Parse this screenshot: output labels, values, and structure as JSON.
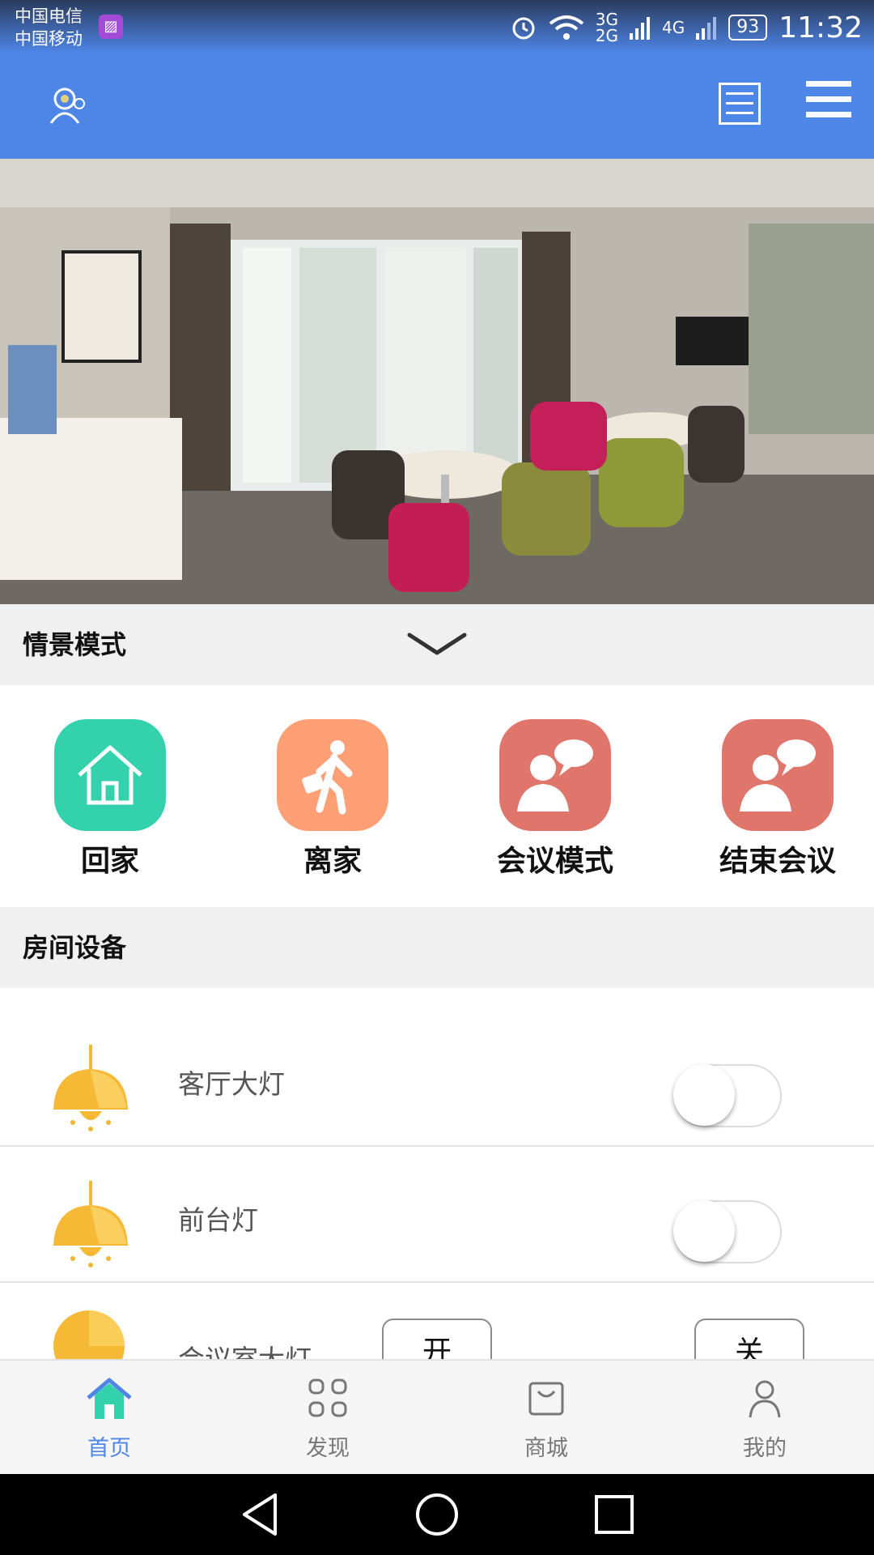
{
  "status_bar": {
    "carrier_1": "中国电信",
    "carrier_2": "中国移动",
    "network_3g": "3G",
    "network_2g": "2G",
    "network_4g": "4G",
    "battery": "93",
    "time": "11:32"
  },
  "header": {
    "left_icon": "user-camera-icon",
    "right_icons": [
      "list-icon",
      "menu-icon"
    ]
  },
  "scene_section": {
    "title": "情景模式",
    "scenes": [
      {
        "label": "回家",
        "icon": "home-icon",
        "color": "#33d1ac"
      },
      {
        "label": "离家",
        "icon": "walking-out-icon",
        "color": "#ff9f76"
      },
      {
        "label": "会议模式",
        "icon": "meeting-icon",
        "color": "#e0756c"
      },
      {
        "label": "结束会议",
        "icon": "meeting-end-icon",
        "color": "#e0756c"
      }
    ]
  },
  "device_section": {
    "title": "房间设备",
    "devices": [
      {
        "name": "客厅大灯",
        "state": "off"
      },
      {
        "name": "前台灯",
        "state": "off"
      },
      {
        "name": "会议室大灯",
        "on_label": "开",
        "off_label": "关"
      }
    ]
  },
  "tabbar": {
    "tabs": [
      {
        "label": "首页",
        "icon": "home-tab-icon",
        "active": true
      },
      {
        "label": "发现",
        "icon": "discover-icon"
      },
      {
        "label": "商城",
        "icon": "shop-bag-icon"
      },
      {
        "label": "我的",
        "icon": "profile-icon"
      }
    ],
    "active_color": "#4e86e8"
  }
}
